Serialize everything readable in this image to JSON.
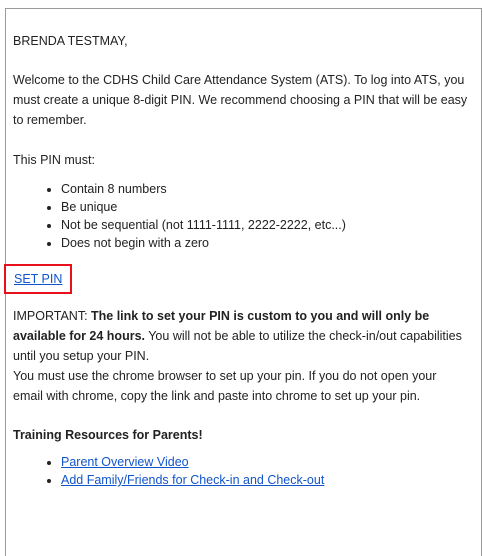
{
  "email": {
    "greeting": "BRENDA TESTMAY,",
    "intro": "Welcome to the CDHS Child Care Attendance System (ATS). To log into ATS, you must create a unique 8-digit PIN. We recommend choosing a PIN that will be easy to remember.",
    "rules_title": "This PIN must:",
    "rules": [
      "Contain 8 numbers",
      "Be unique",
      "Not be sequential (not 1111-1111, 2222-2222, etc...)",
      "Does not begin with a zero"
    ],
    "set_pin_label": "SET PIN",
    "important_prefix": "IMPORTANT: ",
    "important_bold": "The link to set your PIN is custom to you and will only be available for 24 hours.",
    "important_rest": " You will not be able to utilize the check-in/out capabilities until you setup your PIN.",
    "chrome_note": "You must use the chrome browser to set up your pin. If you do not open your email with chrome, copy the link and paste into chrome to set up your pin.",
    "training_title": "Training Resources for Parents!",
    "resources": [
      "Parent Overview Video",
      "Add Family/Friends for Check-in and Check-out"
    ]
  },
  "colors": {
    "link": "#1155cc",
    "highlight_border": "#e8101b",
    "text": "#222222"
  }
}
